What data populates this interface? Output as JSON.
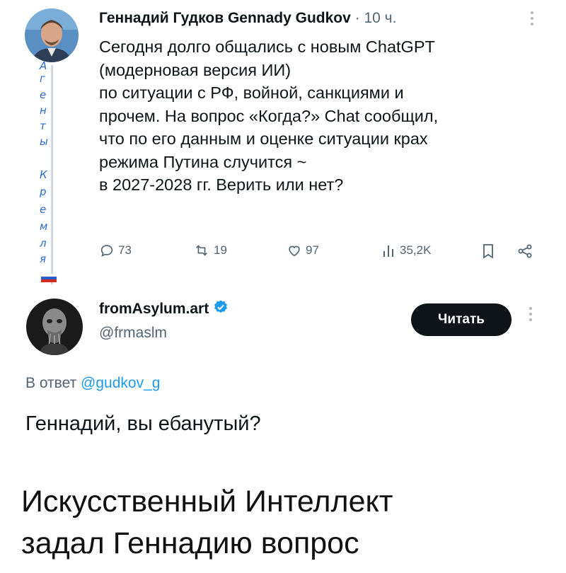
{
  "tweet1": {
    "author_name": "Геннадий Гудков Gennady Gudkov",
    "time": "10 ч.",
    "more_icon": "more-vertical-icon",
    "text_lines": [
      "Сегодня долго общались с новым ChatGPT",
      "(модерновая версия ИИ)",
      "по ситуации с РФ, войной, санкциями и",
      "прочем. На вопрос «Когда?» Chat сообщил,",
      "что по его данным и оценке ситуации крах",
      "режима Путина случится ~",
      "в 2027-2028 гг. Верить или нет?"
    ],
    "annotation_letters": [
      "А",
      "г",
      "е",
      "н",
      "т",
      "ы",
      "К",
      "р",
      "е",
      "м",
      "л",
      "я"
    ],
    "actions": {
      "replies": "73",
      "retweets": "19",
      "likes": "97",
      "views": "35,2K"
    }
  },
  "tweet2": {
    "author_name": "fromAsylum.art",
    "handle": "@frmaslm",
    "follow_label": "Читать",
    "reply_prefix": "В ответ",
    "reply_handle": "@gudkov_g",
    "text": "Геннадий, вы ебанутый?"
  },
  "caption_lines": [
    "Искусственный Интеллект",
    "задал Геннадию вопрос"
  ],
  "colors": {
    "text": "#0f1419",
    "muted": "#536471",
    "link": "#1d9bf0",
    "annotation": "#2b6cd4",
    "button_bg": "#0f1419"
  }
}
